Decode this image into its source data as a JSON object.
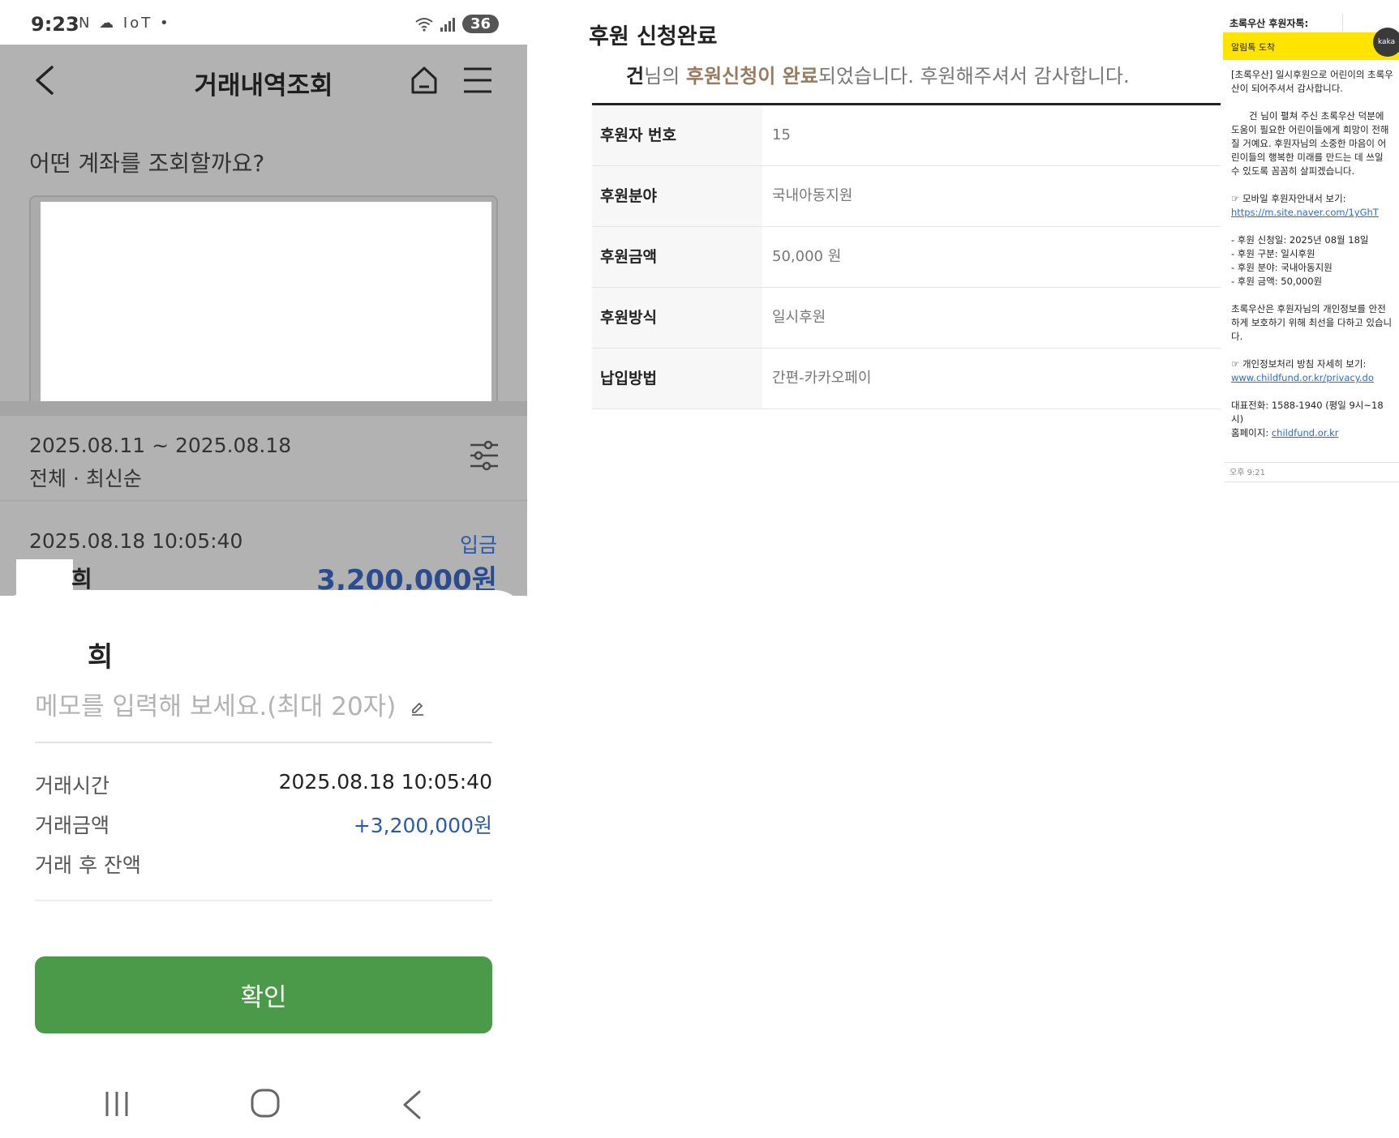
{
  "phone": {
    "status_bar": {
      "time": "9:23",
      "left_icons": "N ☁ IoT •",
      "battery": "36"
    },
    "header": {
      "title": "거래내역조회"
    },
    "account_question": "어떤 계좌를 조회할까요?",
    "filter": {
      "date_range": "2025.08.11 ~ 2025.08.18",
      "sort": "전체 · 최신순"
    },
    "transaction": {
      "time": "2025.08.18 10:05:40",
      "type": "입금",
      "name": "희",
      "amount": "3,200,000원"
    },
    "sheet": {
      "name": "희",
      "memo_placeholder": "메모를 입력해 보세요.(최대 20자)",
      "details": [
        {
          "label": "거래시간",
          "value": "2025.08.18 10:05:40"
        },
        {
          "label": "거래금액",
          "value": "+3,200,000원"
        },
        {
          "label": "거래 후 잔액",
          "value": ""
        }
      ],
      "confirm_label": "확인"
    }
  },
  "donation": {
    "title": "후원 신청완료",
    "message_first": "건",
    "message_part1": "님의 ",
    "message_highlight": "후원신청이 완료",
    "message_part2": "되었습니다. 후원해주셔서 감사합니다.",
    "rows": [
      {
        "label": "후원자 번호",
        "value": "15"
      },
      {
        "label": "후원분야",
        "value": "국내아동지원"
      },
      {
        "label": "후원금액",
        "value": "50,000 원"
      },
      {
        "label": "후원방식",
        "value": "일시후원"
      },
      {
        "label": "납입방법",
        "value": "간편-카카오페이"
      }
    ]
  },
  "kakao": {
    "header": "초록우산 후원자톡:",
    "banner": "알림톡 도착",
    "badge": "kaka",
    "lines": {
      "intro": "[초록우산] 일시후원으로 어린이의 초록우산이 되어주셔서 감사합니다.",
      "body": "건 님이 펼쳐 주신 초록우산 덕분에 도움이 필요한 어린이들에게 희망이 전해질 거예요. 후원자님의 소중한 마음이 어린이들의 행복한 미래를 만드는 데 쓰일 수 있도록 꼼꼼히 살피겠습니다.",
      "mobile_label": "☞ 모바일 후원자안내서 보기:",
      "mobile_link": "https://m.site.naver.com/1yGhT",
      "detail_date": "- 후원 신청일: 2025년 08월 18일",
      "detail_type": "- 후원 구분: 일시후원",
      "detail_field": "- 후원 분야: 국내아동지원",
      "detail_amount": "- 후원 금액: 50,000원",
      "privacy_text": "초록우산은 후원자님의 개인정보를 안전하게 보호하기 위해 최선을 다하고 있습니다.",
      "privacy_label": "☞ 개인정보처리 방침 자세히 보기:",
      "privacy_link": "www.childfund.or.kr/privacy.do",
      "phone": "대표전화: 1588-1940 (평일 9시~18시)",
      "homepage_label": "홈페이지: ",
      "homepage_link": "childfund.or.kr"
    },
    "time": "오후 9:21"
  },
  "colors": {
    "accent_green": "#4a9a4a",
    "deposit_blue": "#2b5aa8",
    "kakao_yellow": "#ffe400",
    "donation_brown": "#9a7a5e"
  },
  "icons": [
    "back-icon",
    "home-icon",
    "menu-icon",
    "filter-icon",
    "edit-icon",
    "wifi-icon",
    "signal-icon",
    "recent-apps-icon",
    "nav-home-icon",
    "nav-back-icon"
  ]
}
